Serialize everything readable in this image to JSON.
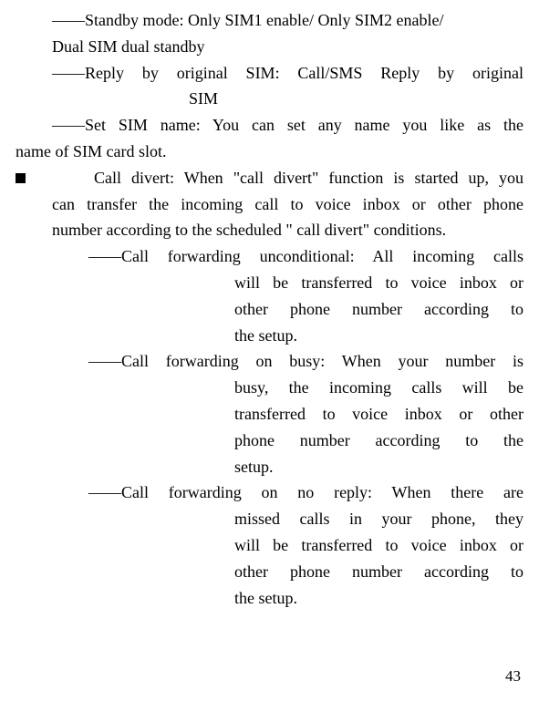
{
  "lines": {
    "l1": "――Standby mode: Only SIM1 enable/ Only SIM2 enable/",
    "l1b": "Dual SIM dual standby",
    "l2": "――Reply by original SIM: Call/SMS Reply by original",
    "l2b": "SIM",
    "l3": "――Set SIM name: You can set any name you like as the",
    "l3b": "name of SIM card slot.",
    "l4": "Call divert: When \"call divert\" function is started up, you",
    "l4b": "can transfer the incoming call to voice inbox or other phone",
    "l4c": "number according to the scheduled \" call divert\" conditions.",
    "l5": "――Call forwarding unconditional: All incoming calls",
    "l5b": "will be transferred to voice inbox or",
    "l5c": "other phone number according to",
    "l5d": "the setup.",
    "l6": "――Call forwarding on busy: When your number is",
    "l6b": "busy, the incoming calls will be",
    "l6c": "transferred to voice inbox or other",
    "l6d": "phone number according to the",
    "l6e": "setup.",
    "l7": "――Call forwarding on no reply: When there are",
    "l7b": "missed calls in your phone, they",
    "l7c": "will be transferred to voice inbox or",
    "l7d": "other phone number according to",
    "l7e": "the setup."
  },
  "page_number": "43"
}
